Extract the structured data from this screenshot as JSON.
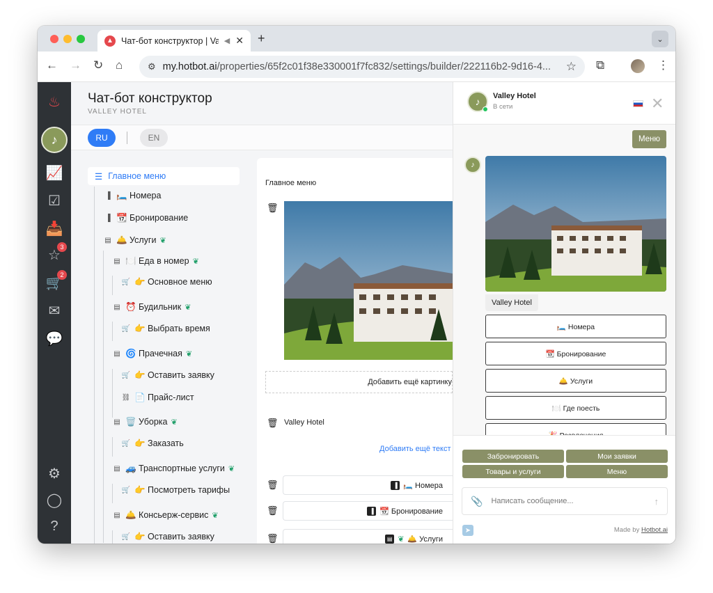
{
  "browser": {
    "tab_title": "Чат-бот конструктор | Va",
    "url_host": "my.hotbot.ai",
    "url_path": "/properties/65f2c01f38e330001f7fc832/settings/builder/222116b2-9d16-4..."
  },
  "sidebar": {
    "badges": {
      "reviews": "3",
      "cart": "2"
    }
  },
  "page": {
    "title": "Чат-бот конструктор",
    "subtitle": "VALLEY HOTEL"
  },
  "languages": [
    "RU",
    "EN"
  ],
  "tree": {
    "root": "Главное меню",
    "items": [
      {
        "label": "🛏️ Номера"
      },
      {
        "label": "📆 Бронирование"
      },
      {
        "label": "🛎️ Услуги"
      },
      {
        "label": "🍽️ Еда в номер"
      },
      {
        "label": "👉 Основное меню"
      },
      {
        "label": "⏰ Будильник"
      },
      {
        "label": "👉 Выбрать время"
      },
      {
        "label": "🌀 Прачечная"
      },
      {
        "label": "👉 Оставить заявку"
      },
      {
        "label": "📄 Прайс-лист"
      },
      {
        "label": "🗑️ Уборка"
      },
      {
        "label": "👉 Заказать"
      },
      {
        "label": "🚙 Транспортные услуги"
      },
      {
        "label": "👉 Посмотреть тарифы"
      },
      {
        "label": "🛎️ Консьерж-сервис"
      },
      {
        "label": "👉 Оставить заявку"
      }
    ]
  },
  "editor": {
    "label": "Главное меню",
    "add_image": "Добавить ещё картинку",
    "text_value": "Valley Hotel",
    "add_text": "Добавить ещё текст",
    "buttons": [
      "🛏️ Номера",
      "📆 Бронирование",
      "🛎️ Услуги"
    ]
  },
  "chat": {
    "name": "Valley Hotel",
    "status": "В сети",
    "menu_pill": "Меню",
    "caption": "Valley Hotel",
    "quick_buttons": [
      "🛏️ Номера",
      "📆 Бронирование",
      "🛎️ Услуги",
      "🍽️ Где поесть",
      "🎉 Развлечения"
    ],
    "footer_buttons": [
      "Забронировать",
      "Мои заявки",
      "Товары и услуги",
      "Меню"
    ],
    "input_placeholder": "Написать сообщение...",
    "made_by_prefix": "Made by",
    "made_by_link": "Hotbot.ai"
  }
}
